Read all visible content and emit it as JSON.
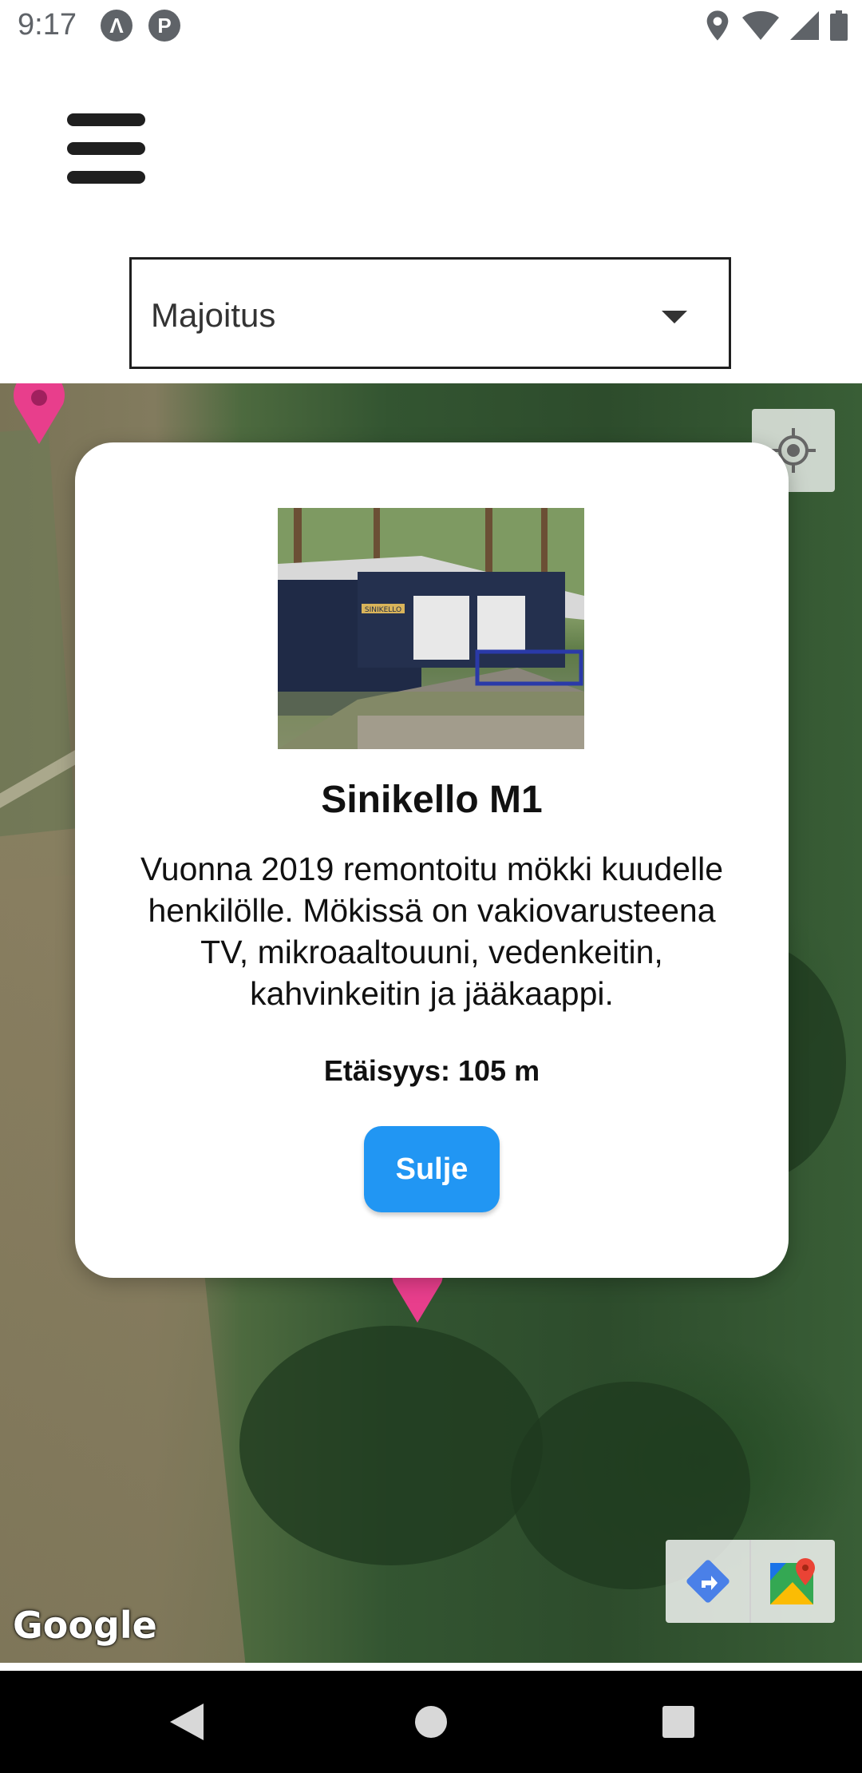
{
  "status_bar": {
    "time": "9:17",
    "icons": [
      "app-a-icon",
      "app-p-icon",
      "location-icon",
      "wifi-icon",
      "signal-icon",
      "battery-icon"
    ]
  },
  "filter": {
    "selected": "Majoitus"
  },
  "modal": {
    "title": "Sinikello M1",
    "description": "Vuonna 2019 remontoitu mökki kuudelle henkilölle. Mökissä on vakiovarusteena TV, mikroaaltouuni, vedenkeitin, kahvinkeitin ja jääkaappi.",
    "distance": "Etäisyys: 105 m",
    "close_label": "Sulje",
    "photo_sign": "SINIKELLO"
  },
  "map": {
    "attribution": "Google",
    "pin_color": "#e83e8c"
  },
  "colors": {
    "accent": "#2196f3",
    "navbar": "#000000"
  }
}
